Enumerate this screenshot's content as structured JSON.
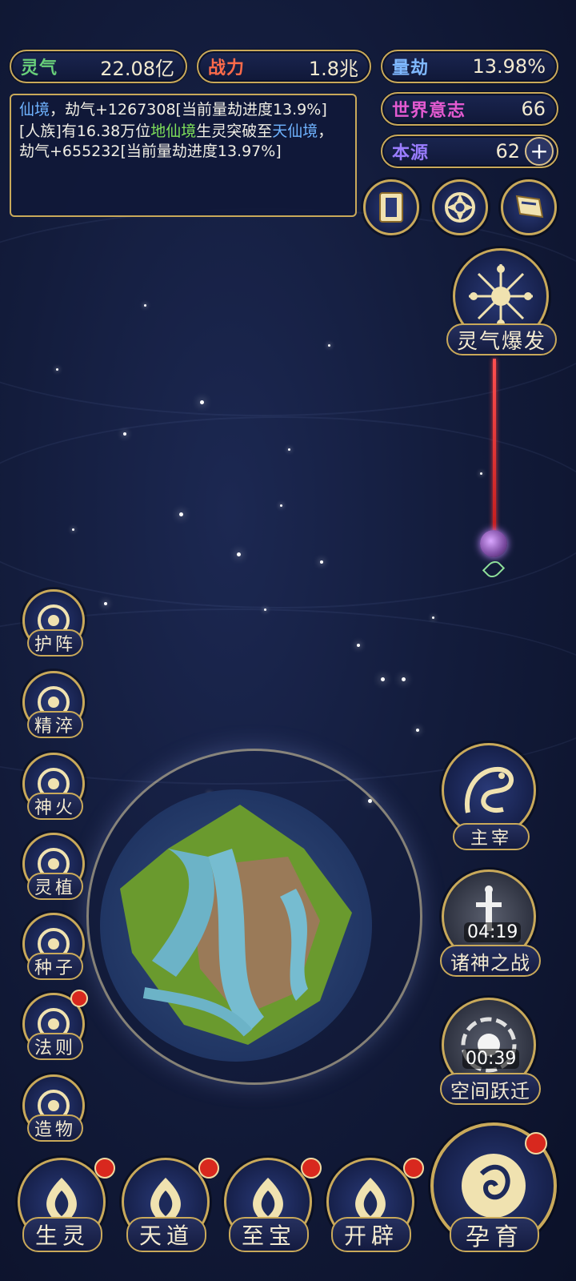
{
  "stats": {
    "lingqi": {
      "label": "灵气",
      "value": "22.08亿",
      "color": "#69d07a"
    },
    "zhanli": {
      "label": "战力",
      "value": "1.8兆",
      "color": "#ff6b4a"
    },
    "liangjie": {
      "label": "量劫",
      "value": "13.98%",
      "color": "#7fb8ff"
    },
    "shijieyizhi": {
      "label": "世界意志",
      "value": "66",
      "color": "#e35ad0"
    },
    "benyuan": {
      "label": "本源",
      "value": "62",
      "color": "#9a7dff"
    }
  },
  "log": {
    "line1": [
      {
        "text": "仙境",
        "color": "blue"
      },
      {
        "text": "，劫气+1267308[当前量劫进度13.9%]",
        "color": "white"
      }
    ],
    "line2": [
      {
        "text": "[人族]有16.38万位",
        "color": "white"
      },
      {
        "text": "地仙境",
        "color": "green"
      },
      {
        "text": "生灵突破至",
        "color": "white"
      },
      {
        "text": "天仙境",
        "color": "blue"
      },
      {
        "text": "，劫气+655232[当前量劫进度13.97%]",
        "color": "white"
      }
    ]
  },
  "top_icons": [
    "card-icon",
    "vortex-icon",
    "flag-icon"
  ],
  "burst": {
    "label": "灵气爆发"
  },
  "left_menu": [
    {
      "label": "护阵",
      "icon": "taiji-icon",
      "badge": false
    },
    {
      "label": "精淬",
      "icon": "lotus-flame-icon",
      "badge": false
    },
    {
      "label": "神火",
      "icon": "fire-icon",
      "badge": false
    },
    {
      "label": "灵植",
      "icon": "plant-icon",
      "badge": false
    },
    {
      "label": "种子",
      "icon": "flower-icon",
      "badge": false
    },
    {
      "label": "法则",
      "icon": "rune-face-icon",
      "badge": true
    },
    {
      "label": "造物",
      "icon": "diamond-icon",
      "badge": false
    }
  ],
  "right_menu": {
    "zhuzai": {
      "label": "主宰",
      "icon": "dragon-icon"
    },
    "zhushen": {
      "label": "诸神之战",
      "timer": "04:19",
      "icon": "sword-icon"
    },
    "kongjian": {
      "label": "空间跃迁",
      "timer": "00:39",
      "icon": "portal-icon"
    }
  },
  "bottom_menu": [
    {
      "label": "生灵",
      "icon": "lotus-icon",
      "badge": true
    },
    {
      "label": "天道",
      "icon": "wave-icon",
      "badge": true
    },
    {
      "label": "至宝",
      "icon": "treasure-icon",
      "badge": true
    },
    {
      "label": "开辟",
      "icon": "axe-icon",
      "badge": true
    }
  ],
  "yunyu": {
    "label": "孕育",
    "icon": "embryo-icon",
    "badge": true
  }
}
